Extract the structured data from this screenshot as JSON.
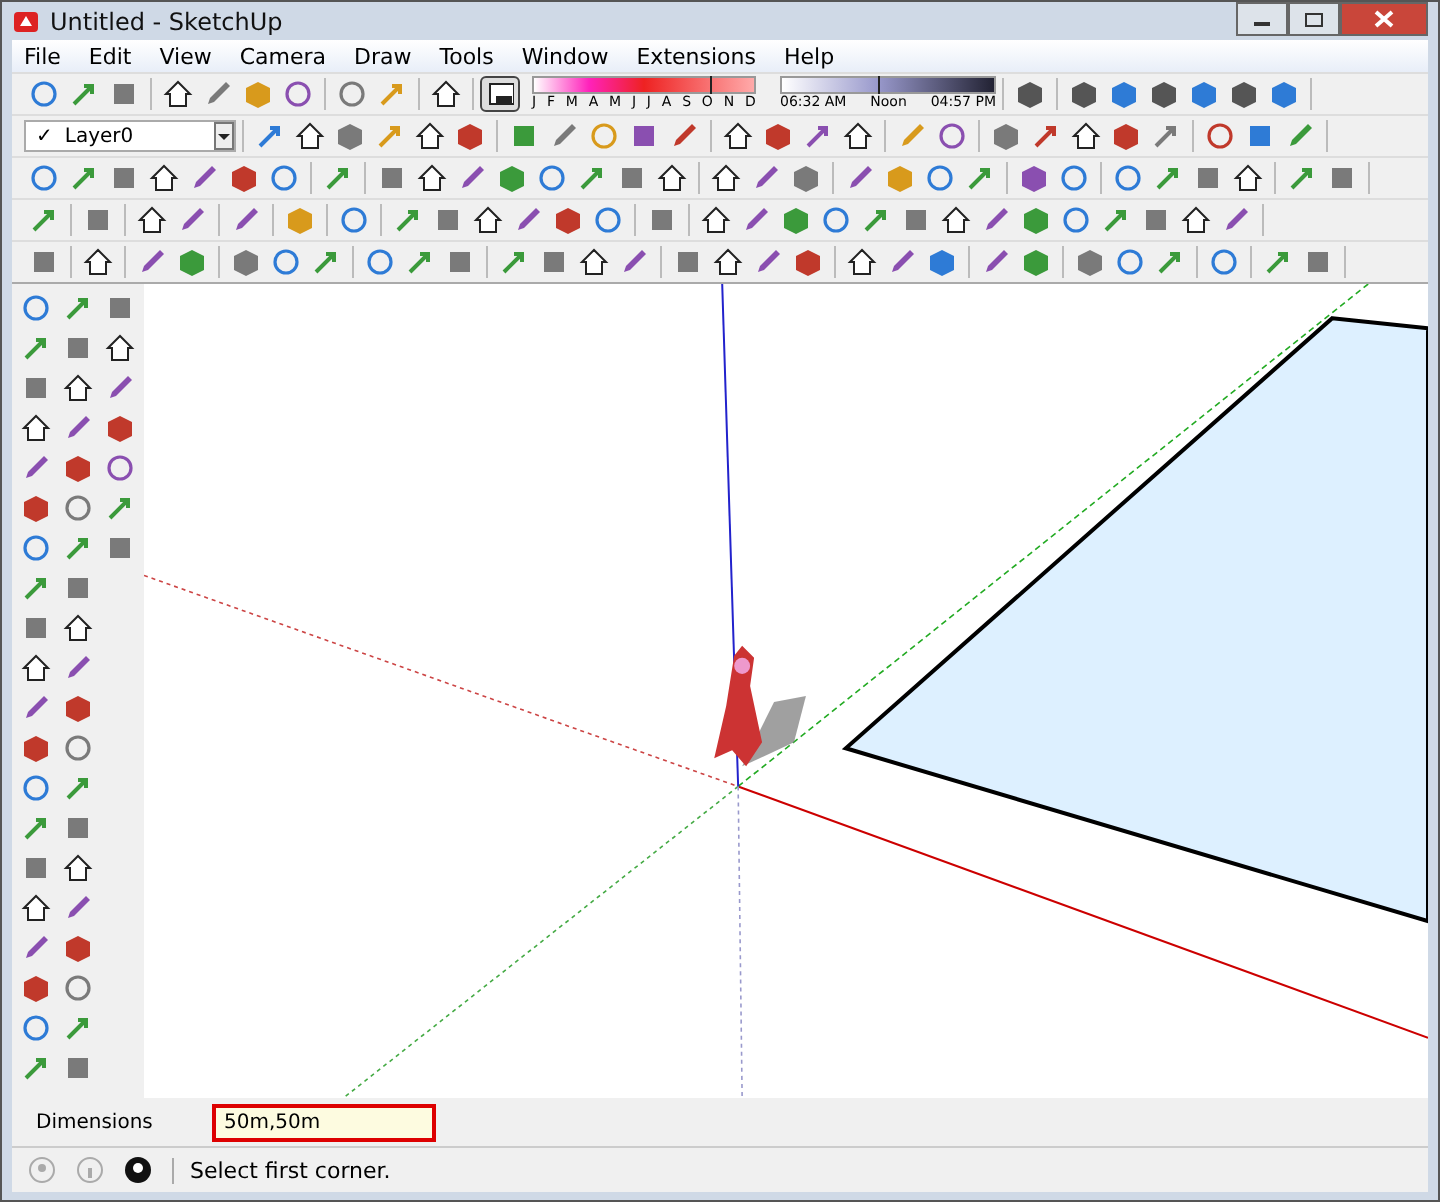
{
  "window": {
    "title": "Untitled - SketchUp"
  },
  "menu": [
    "File",
    "Edit",
    "View",
    "Camera",
    "Draw",
    "Tools",
    "Window",
    "Extensions",
    "Help"
  ],
  "shadow_settings": {
    "date_slider": {
      "level": 0.8
    },
    "time_slider": {
      "level": 0.45
    },
    "months": [
      "J",
      "F",
      "M",
      "A",
      "M",
      "J",
      "J",
      "A",
      "S",
      "O",
      "N",
      "D"
    ],
    "times": [
      "06:32 AM",
      "Noon",
      "04:57 PM"
    ]
  },
  "layer": {
    "check": "✓",
    "name": "Layer0"
  },
  "measurements": {
    "label": "Dimensions",
    "value": "50m,50m"
  },
  "status_bar": {
    "text": "Select first corner."
  }
}
